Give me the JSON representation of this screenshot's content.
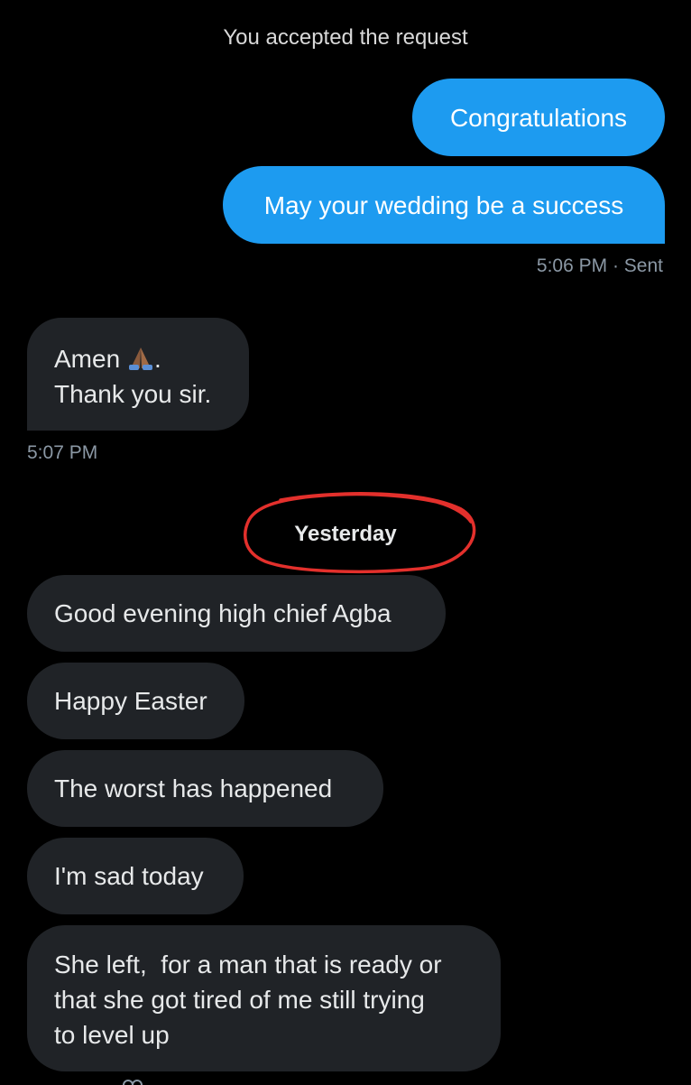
{
  "system_note": "You accepted the request",
  "sent_messages": [
    {
      "text": "Congratulations"
    },
    {
      "text": "May your wedding be a success"
    }
  ],
  "sent_meta": "5:06 PM · Sent",
  "received_group_1": {
    "line1": "Amen",
    "line1_suffix": ".",
    "line2": "Thank you sir.",
    "emoji": "folded-hands-icon",
    "time": "5:07 PM"
  },
  "day_divider": "Yesterday",
  "received_group_2": [
    {
      "text": "Good evening high chief Agba"
    },
    {
      "text": "Happy Easter"
    },
    {
      "text": "The worst has happened"
    },
    {
      "text": "I'm sad today"
    },
    {
      "lines": [
        "She left,  for a man that is ready or",
        "that she got tired of me still trying",
        "to level up"
      ]
    }
  ],
  "colors": {
    "background": "#000000",
    "sent_bubble": "#1d9bf0",
    "received_bubble": "#202327",
    "annotation": "#e3302c"
  }
}
